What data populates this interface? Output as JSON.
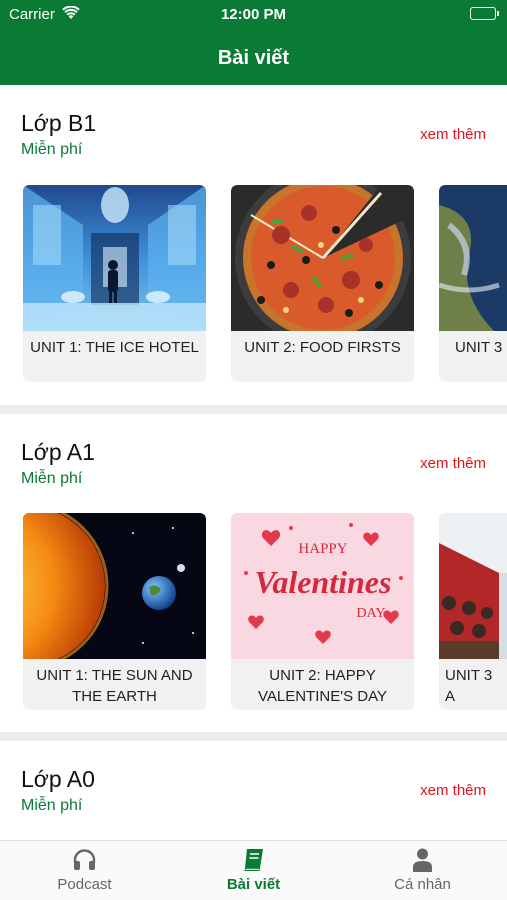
{
  "status_bar": {
    "carrier": "Carrier",
    "time": "12:00 PM"
  },
  "navbar": {
    "title": "Bài viết"
  },
  "sections": [
    {
      "title": "Lớp B1",
      "subtitle": "Miễn phí",
      "more_label": "xem thêm",
      "cards": [
        {
          "title": "UNIT 1: THE ICE HOTEL",
          "image": "ice-hotel-corridor"
        },
        {
          "title": "UNIT 2: FOOD FIRSTS",
          "image": "pizza"
        },
        {
          "title": "UNIT 3",
          "image": "earth-from-space"
        }
      ]
    },
    {
      "title": "Lớp A1",
      "subtitle": "Miễn phí",
      "more_label": "xem thêm",
      "cards": [
        {
          "title": "UNIT 1: THE SUN AND THE EARTH",
          "image": "sun-and-earth"
        },
        {
          "title": "UNIT 2: HAPPY VALENTINE'S DAY",
          "image": "happy-valentines-day"
        },
        {
          "title": "UNIT 3 A",
          "image": "airplane-cabin"
        }
      ]
    },
    {
      "title": "Lớp A0",
      "subtitle": "Miễn phí",
      "more_label": "xem thêm",
      "cards": []
    }
  ],
  "valentine_art": {
    "line1": "HAPPY",
    "line2": "Valentines",
    "line3": "DAY"
  },
  "tabs": [
    {
      "label": "Podcast",
      "icon": "headphones-icon",
      "active": false
    },
    {
      "label": "Bài viết",
      "icon": "book-icon",
      "active": true
    },
    {
      "label": "Cá nhân",
      "icon": "person-icon",
      "active": false
    }
  ],
  "colors": {
    "brand_green": "#0a7a34",
    "more_red": "#e0141c",
    "card_bg": "#f1f1f1",
    "divider": "#ececec"
  }
}
